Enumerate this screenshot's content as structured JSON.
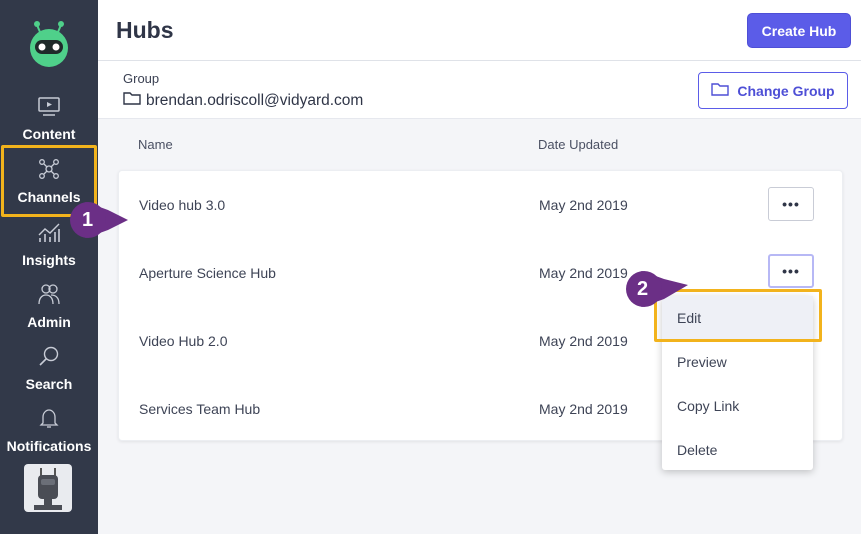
{
  "sidebar": {
    "items": [
      {
        "label": "Content",
        "icon": "video-icon"
      },
      {
        "label": "Channels",
        "icon": "network-icon"
      },
      {
        "label": "Insights",
        "icon": "chart-icon"
      },
      {
        "label": "Admin",
        "icon": "users-icon"
      },
      {
        "label": "Search",
        "icon": "search-icon"
      },
      {
        "label": "Notifications",
        "icon": "bell-icon"
      }
    ]
  },
  "header": {
    "title": "Hubs",
    "create_label": "Create Hub"
  },
  "group": {
    "label": "Group",
    "value": "brendan.odriscoll@vidyard.com",
    "change_label": "Change Group"
  },
  "table": {
    "columns": [
      "Name",
      "Date Updated"
    ],
    "rows": [
      {
        "name": "Video hub 3.0",
        "date": "May 2nd 2019"
      },
      {
        "name": "Aperture Science Hub",
        "date": "May 2nd 2019"
      },
      {
        "name": "Video Hub 2.0",
        "date": "May 2nd 2019"
      },
      {
        "name": "Services Team Hub",
        "date": "May 2nd 2019"
      }
    ],
    "more_label": "•••"
  },
  "menu": {
    "items": [
      "Edit",
      "Preview",
      "Copy Link",
      "Delete"
    ]
  },
  "callouts": {
    "one": "1",
    "two": "2"
  },
  "colors": {
    "sidebar": "#323949",
    "accent": "#5b5ce8",
    "highlight": "#f2b31c",
    "callout": "#6b2f86"
  }
}
